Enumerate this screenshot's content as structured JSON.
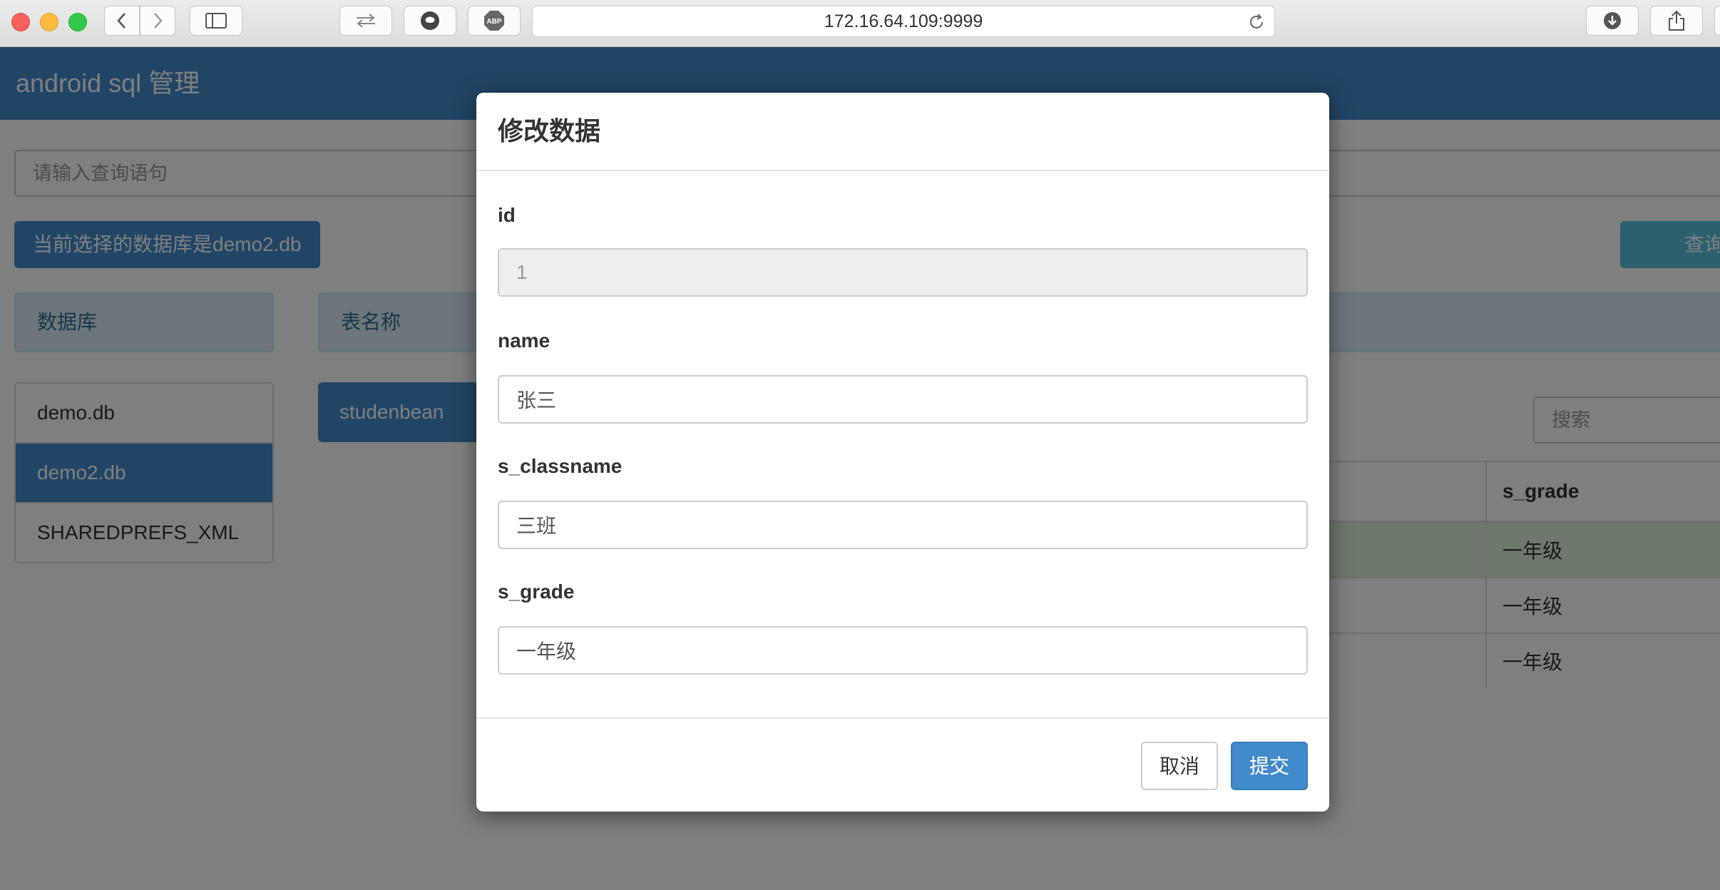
{
  "browser": {
    "url": "172.16.64.109:9999",
    "icons": [
      "back-icon",
      "forward-icon",
      "sidebar-icon",
      "sync-icon",
      "github-icon",
      "adblock-icon",
      "reload-icon",
      "download-icon",
      "share-icon"
    ],
    "adblock_label": "ABP"
  },
  "page": {
    "app_title": "android sql 管理",
    "query_placeholder": "请输入查询语句",
    "current_db_label": "当前选择的数据库是demo2.db",
    "query_button": "查询",
    "db_panel_title": "数据库",
    "table_panel_title": "表名称",
    "databases": [
      {
        "label": "demo.db",
        "active": false
      },
      {
        "label": "demo2.db",
        "active": true
      },
      {
        "label": "SHAREDPREFS_XML",
        "active": false
      }
    ],
    "tables": [
      "studenbean"
    ],
    "search_placeholder": "搜索",
    "table": {
      "header": "s_grade",
      "rows": [
        "一年级",
        "一年级",
        "一年级"
      ]
    }
  },
  "modal": {
    "title": "修改数据",
    "fields": [
      {
        "label": "id",
        "value": "1",
        "disabled": true
      },
      {
        "label": "name",
        "value": "张三",
        "disabled": false
      },
      {
        "label": "s_classname",
        "value": "三班",
        "disabled": false
      },
      {
        "label": "s_grade",
        "value": "一年级",
        "disabled": false
      }
    ],
    "cancel_label": "取消",
    "submit_label": "提交"
  },
  "colors": {
    "primary": "#428bca",
    "info": "#5bc0de",
    "panel_bg": "#d9edf7",
    "success_row": "#dff0d8"
  }
}
